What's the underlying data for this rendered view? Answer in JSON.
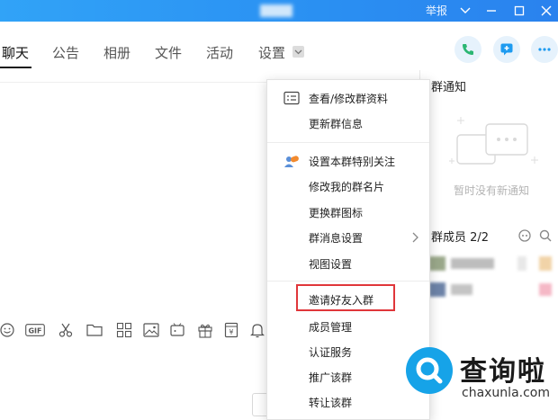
{
  "titlebar": {
    "report_label": "举报",
    "icons": [
      "chevron-down-icon",
      "minimize-icon",
      "maximize-icon",
      "close-icon"
    ],
    "color": "#2a8ff2"
  },
  "tabs": [
    {
      "label": "聊天",
      "active": true
    },
    {
      "label": "公告"
    },
    {
      "label": "相册"
    },
    {
      "label": "文件"
    },
    {
      "label": "活动"
    },
    {
      "label": "设置"
    }
  ],
  "right_panel": {
    "notice_title": "群通知",
    "notice_empty": "暂时没有新通知",
    "members_header": "群成员 2/2"
  },
  "menu": {
    "items": [
      "查看/修改群资料",
      "更新群信息",
      "设置本群特别关注",
      "修改我的群名片",
      "更换群图标",
      "群消息设置",
      "视图设置",
      "邀请好友入群",
      "成员管理",
      "认证服务",
      "推广该群",
      "转让该群"
    ],
    "highlight_color": "#e0363a"
  },
  "toolbar_icons": [
    "emoji-icon",
    "gif-icon",
    "scissors-icon",
    "folder-icon",
    "font-icon",
    "image-icon",
    "shake-icon",
    "gift-icon",
    "red-packet-icon",
    "bell-icon"
  ],
  "watermark": {
    "cn": "查询啦",
    "en": "chaxunla.com"
  },
  "accent": "#1e9bf0"
}
